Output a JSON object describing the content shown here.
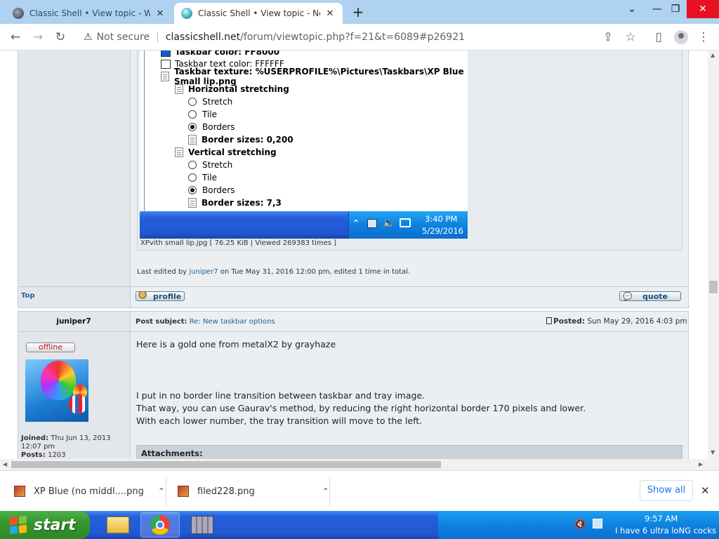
{
  "browser": {
    "tabs": [
      {
        "title": "Classic Shell • View topic - Windo",
        "close": "✕",
        "active": false
      },
      {
        "title": "Classic Shell • View topic - New t",
        "close": "✕",
        "active": true
      }
    ],
    "new_tab": "+",
    "window_controls": {
      "dropdown": "⌄",
      "minimize": "—",
      "restore": "❐",
      "close": "✕"
    },
    "nav": {
      "back": "←",
      "forward": "→",
      "reload": "↻",
      "share": "⇪",
      "star": "☆",
      "sidepanel": "▯",
      "profile": "●",
      "menu": "⋮"
    },
    "address": {
      "security_label": "Not secure",
      "host": "classicshell.net",
      "path": "/forum/viewtopic.php?f=21&t=6089#p26921"
    }
  },
  "screenshot_tree": {
    "taskbar_color": "Taskbar color: FF8000",
    "taskbar_text_color": "Taskbar text color: FFFFFF",
    "taskbar_texture": "Taskbar texture: %USERPROFILE%\\Pictures\\Taskbars\\XP Blue Small lip.png",
    "horizontal": "Horizontal stretching",
    "vertical": "Vertical stretching",
    "opt_stretch": "Stretch",
    "opt_tile": "Tile",
    "opt_borders": "Borders",
    "h_border_sizes": "Border sizes: 0,200",
    "v_border_sizes": "Border sizes: 7,3",
    "tray_time": "3:40 PM",
    "tray_date": "5/29/2016"
  },
  "attachment_caption": "XPvith small lip.jpg [ 76.25 KiB | Viewed 269383 times ]",
  "edit_note": {
    "prefix": "Last edited by ",
    "user": "juniper7",
    "suffix": " on Tue May 31, 2016 12:00 pm, edited 1 time in total."
  },
  "actions": {
    "top": "Top",
    "profile": "profile",
    "quote": "quote"
  },
  "post": {
    "author": "juniper7",
    "subject_label": "Post subject:",
    "subject": "Re: New taskbar options",
    "posted_label": "Posted:",
    "posted": "Sun May 29, 2016 4:03 pm",
    "status": "offline",
    "joined_label": "Joined:",
    "joined": "Thu Jun 13, 2013 12:07 pm",
    "posts_label": "Posts:",
    "posts": "1203",
    "line1": "Here is a gold one from metalX2 by grayhaze",
    "line2": "I put in no border line transition between taskbar and tray image.",
    "line3": "That way, you can use Gaurav's method, by reducing the right horizontal border 170 pixels and lower.",
    "line4": "With each lower number, the tray transition will move to the left.",
    "attachments": "Attachments:"
  },
  "downloads": {
    "items": [
      "XP Blue (no middl....png",
      "filed228.png"
    ],
    "show_all": "Show all",
    "close": "✕"
  },
  "taskbar": {
    "start": "start",
    "clock_time": "9:57 AM",
    "clock_text": "I have 6 ultra loNG cocks"
  }
}
